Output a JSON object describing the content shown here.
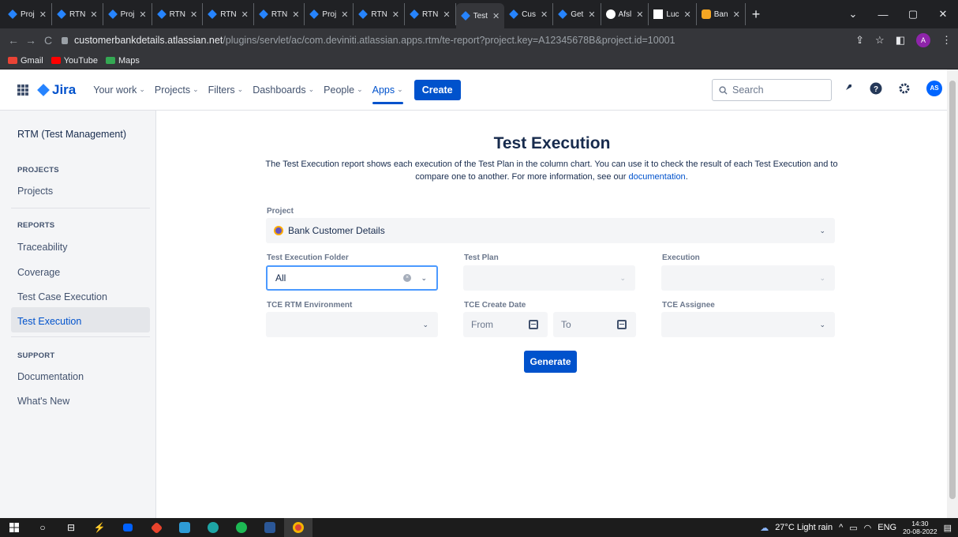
{
  "browser": {
    "tabs": [
      {
        "label": "Proj",
        "icon": "jira-icon"
      },
      {
        "label": "RTN",
        "icon": "jira-icon"
      },
      {
        "label": "Proj",
        "icon": "jira-icon"
      },
      {
        "label": "RTN",
        "icon": "jira-icon"
      },
      {
        "label": "RTN",
        "icon": "jira-icon"
      },
      {
        "label": "RTN",
        "icon": "jira-icon"
      },
      {
        "label": "Proj",
        "icon": "jira-icon"
      },
      {
        "label": "RTN",
        "icon": "jira-icon"
      },
      {
        "label": "RTN",
        "icon": "jira-icon"
      },
      {
        "label": "Test",
        "icon": "jira-icon",
        "active": true
      },
      {
        "label": "Cus",
        "icon": "jira-icon"
      },
      {
        "label": "Get",
        "icon": "jira-icon"
      },
      {
        "label": "Afsl",
        "icon": "github-icon"
      },
      {
        "label": "Luc",
        "icon": "lucid-icon"
      },
      {
        "label": "Ban",
        "icon": "bamboo-icon"
      }
    ],
    "tab_close": "✕",
    "new_tab": "+",
    "url_host": "customerbankdetails.atlassian.net",
    "url_path": "/plugins/servlet/ac/com.deviniti.atlassian.apps.rtm/te-report?project.key=A12345678B&project.id=10001",
    "profile_initial": "A",
    "bookmarks": [
      {
        "label": "Gmail",
        "color": "#ea4335"
      },
      {
        "label": "YouTube",
        "color": "#ff0000"
      },
      {
        "label": "Maps",
        "color": "#34a853"
      }
    ]
  },
  "jira": {
    "logo": "Jira",
    "menu": [
      {
        "label": "Your work",
        "chev": "⌄"
      },
      {
        "label": "Projects",
        "chev": "⌄"
      },
      {
        "label": "Filters",
        "chev": "⌄"
      },
      {
        "label": "Dashboards",
        "chev": "⌄"
      },
      {
        "label": "People",
        "chev": "⌄"
      },
      {
        "label": "Apps",
        "chev": "⌄",
        "selected": true
      }
    ],
    "create_label": "Create",
    "search_placeholder": "Search",
    "avatar_initials": "AS"
  },
  "sidebar": {
    "title": "RTM (Test Management)",
    "projects_heading": "PROJECTS",
    "projects_item": "Projects",
    "reports_heading": "REPORTS",
    "reports": [
      "Traceability",
      "Coverage",
      "Test Case Execution",
      "Test Execution"
    ],
    "active_report": "Test Execution",
    "support_heading": "SUPPORT",
    "support": [
      "Documentation",
      "What's New"
    ]
  },
  "main": {
    "title": "Test Execution",
    "description_1": "The Test Execution report shows each execution of the Test Plan in the column chart. You can use it to check the result of each Test Execution and to",
    "description_2": "compare one to another. For more information, see our ",
    "description_link": "documentation",
    "description_end": ".",
    "project_label": "Project",
    "project_value": "Bank Customer Details",
    "folder_label": "Test Execution Folder",
    "folder_value": "All",
    "plan_label": "Test Plan",
    "plan_value": "",
    "execution_label": "Execution",
    "execution_value": "",
    "env_label": "TCE RTM Environment",
    "env_value": "",
    "date_label": "TCE Create Date",
    "date_from_placeholder": "From",
    "date_to_placeholder": "To",
    "assignee_label": "TCE Assignee",
    "assignee_value": "",
    "generate_label": "Generate",
    "dropdown_glyph": "⌄",
    "clear_glyph": "×"
  },
  "taskbar": {
    "weather": "27°C  Light rain",
    "lang": "ENG",
    "time": "14:30",
    "date": "20-08-2022"
  }
}
